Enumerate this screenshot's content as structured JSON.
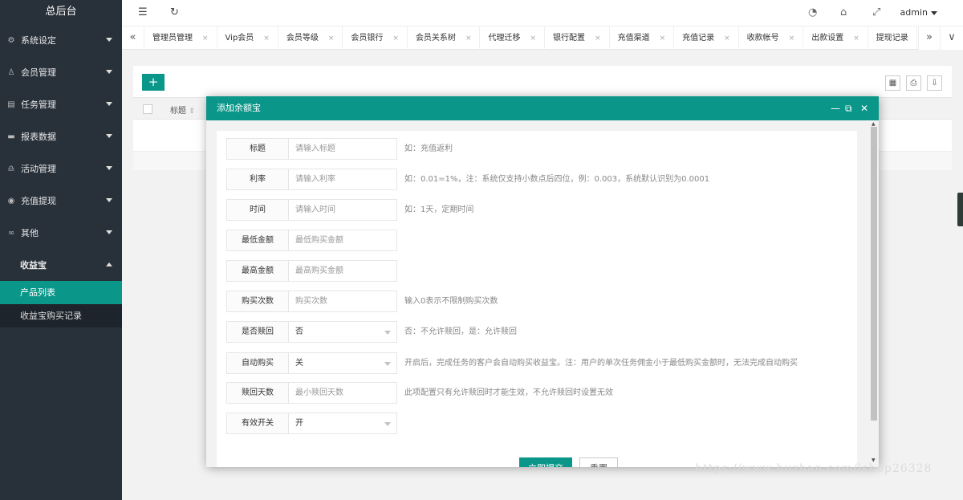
{
  "sidebar": {
    "logo": "总后台",
    "items": [
      {
        "label": "系统设定",
        "icon": "⚙"
      },
      {
        "label": "会员管理",
        "icon": "♙"
      },
      {
        "label": "任务管理",
        "icon": "▤"
      },
      {
        "label": "报表数据",
        "icon": "▬"
      },
      {
        "label": "活动管理",
        "icon": "♎"
      },
      {
        "label": "充值提现",
        "icon": "◉"
      },
      {
        "label": "其他",
        "icon": "∞"
      }
    ],
    "open_item": "收益宝",
    "sub_items": [
      "产品列表",
      "收益宝购买记录"
    ]
  },
  "header": {
    "menu_icon": "☰",
    "refresh_icon": "↻",
    "dashboard_icon": "◔",
    "tag_icon": "⌂",
    "fullscreen_icon": "⤢",
    "user": "admin"
  },
  "tabs": {
    "prev": "«",
    "next": "»",
    "more": "∨",
    "items": [
      "管理员管理",
      "Vip会员",
      "会员等级",
      "会员银行",
      "会员关系树",
      "代理迁移",
      "银行配置",
      "充值渠道",
      "充值记录",
      "收款帐号",
      "出款设置",
      "提现记录"
    ],
    "close": "×"
  },
  "content": {
    "add": "+",
    "tools": [
      "▦",
      "⎙",
      "⇩"
    ],
    "col_title": "标题",
    "sort_icon": "⇕"
  },
  "modal": {
    "title": "添加余额宝",
    "min": "—",
    "max": "⧉",
    "close": "✕",
    "fields": [
      {
        "label": "标题",
        "placeholder": "请输入标题",
        "tip": "如：充值返利"
      },
      {
        "label": "利率",
        "placeholder": "请输入利率",
        "tip": "如：0.01=1%，注：系统仅支持小数点后四位，例：0.003，系统默认识别为0.0001"
      },
      {
        "label": "时间",
        "placeholder": "请输入时间",
        "tip": "如：1天，定期时间"
      },
      {
        "label": "最低金额",
        "placeholder": "最低购买金额",
        "tip": ""
      },
      {
        "label": "最高金额",
        "placeholder": "最高购买金额",
        "tip": ""
      },
      {
        "label": "购买次数",
        "placeholder": "购买次数",
        "tip": "输入0表示不限制购买次数"
      },
      {
        "label": "是否赎回",
        "value": "否",
        "tip": "否：不允许赎回，是：允许赎回"
      },
      {
        "label": "自动购买",
        "value": "关",
        "tip": "开启后，完成任务的客户会自动购买收益宝。注：用户的单次任务佣金小于最低购买金额时，无法完成自动购买"
      },
      {
        "label": "赎回天数",
        "placeholder": "最小赎回天数",
        "tip": "此项配置只有允许赎回时才能生效，不允许赎回时设置无效"
      },
      {
        "label": "有效开关",
        "value": "开",
        "tip": ""
      }
    ],
    "submit": "立即提交",
    "reset": "重置"
  },
  "watermark": "https://www.huzhan.com/ishop26328",
  "colors": {
    "accent": "#0a9688",
    "sidebar": "#28303a"
  }
}
